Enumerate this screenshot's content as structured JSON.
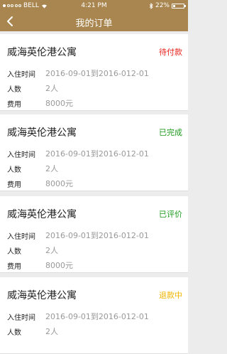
{
  "status_bar": {
    "carrier": "BELL",
    "time": "4:21 PM",
    "battery": "22%",
    "battery_level": 0.22
  },
  "nav": {
    "title": "我的订单"
  },
  "labels": {
    "checkin": "入住时间",
    "people": "人数",
    "fee": "费用"
  },
  "colors": {
    "header": "#a9864f",
    "pending": "#e8231f",
    "completed": "#1f9a1f",
    "reviewed": "#1f9a1f",
    "refunding": "#f0b400"
  },
  "orders": [
    {
      "name": "威海英伦港公寓",
      "status": "待付款",
      "status_color": "#e8231f",
      "checkin": "2016-09-01到2016-012-01",
      "people": "2人",
      "fee": "8000元"
    },
    {
      "name": "威海英伦港公寓",
      "status": "已完成",
      "status_color": "#1f9a1f",
      "checkin": "2016-09-01到2016-012-01",
      "people": "2人",
      "fee": "8000元"
    },
    {
      "name": "威海英伦港公寓",
      "status": "已评价",
      "status_color": "#1f9a1f",
      "checkin": "2016-09-01到2016-012-01",
      "people": "2人",
      "fee": "8000元"
    },
    {
      "name": "威海英伦港公寓",
      "status": "退款中",
      "status_color": "#f0b400",
      "checkin": "2016-09-01到2016-012-01",
      "people": "2人",
      "fee": ""
    }
  ]
}
